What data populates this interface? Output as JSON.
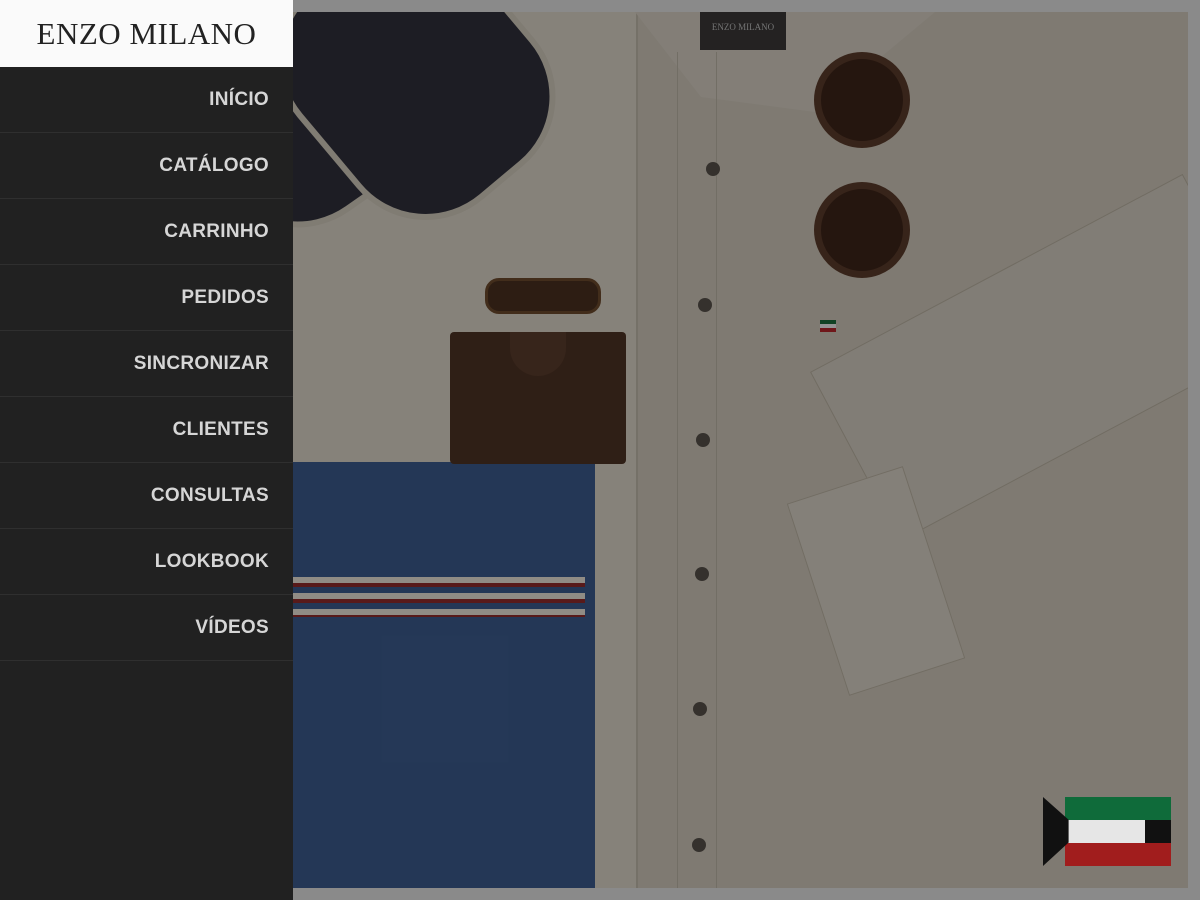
{
  "brand": {
    "name": "ENZO MILANO"
  },
  "menu": {
    "items": [
      {
        "label": "INÍCIO"
      },
      {
        "label": "CATÁLOGO"
      },
      {
        "label": "CARRINHO"
      },
      {
        "label": "PEDIDOS"
      },
      {
        "label": "SINCRONIZAR"
      },
      {
        "label": "CLIENTES"
      },
      {
        "label": "CONSULTAS"
      },
      {
        "label": "LOOKBOOK"
      },
      {
        "label": "VÍDEOS"
      }
    ]
  },
  "hero": {
    "shirt_label": "ENZO MILANO"
  },
  "language_selector": {
    "icon": "kuwait-flag-icon"
  },
  "colors": {
    "drawer_bg": "#212121",
    "menu_text": "#d6d6d6",
    "brand_bg": "#fafafa"
  }
}
